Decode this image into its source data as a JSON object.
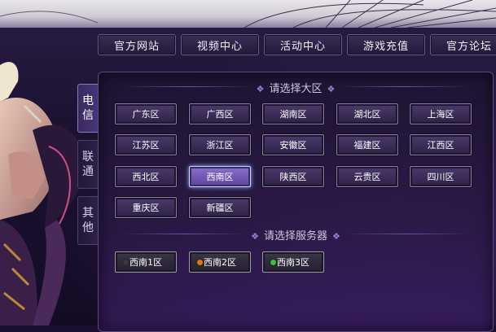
{
  "nav": [
    "官方网站",
    "视频中心",
    "活动中心",
    "游戏充值",
    "官方论坛"
  ],
  "side_tabs": [
    {
      "chars": [
        "电",
        "信"
      ],
      "active": true
    },
    {
      "chars": [
        "联",
        "通"
      ],
      "active": false
    },
    {
      "chars": [
        "其",
        "他"
      ],
      "active": false
    }
  ],
  "zone_section_title": "请选择大区",
  "zones": [
    "广东区",
    "广西区",
    "湖南区",
    "湖北区",
    "上海区",
    "江苏区",
    "浙江区",
    "安徽区",
    "福建区",
    "江西区",
    "西北区",
    "西南区",
    "陕西区",
    "云贵区",
    "四川区",
    "重庆区",
    "新疆区"
  ],
  "selected_zone": "西南区",
  "server_section_title": "请选择服务器",
  "servers": [
    {
      "name": "西南1区",
      "status_color": "#3a3a3a"
    },
    {
      "name": "西南2区",
      "status_color": "#e07a10"
    },
    {
      "name": "西南3区",
      "status_color": "#3ac23a"
    }
  ]
}
